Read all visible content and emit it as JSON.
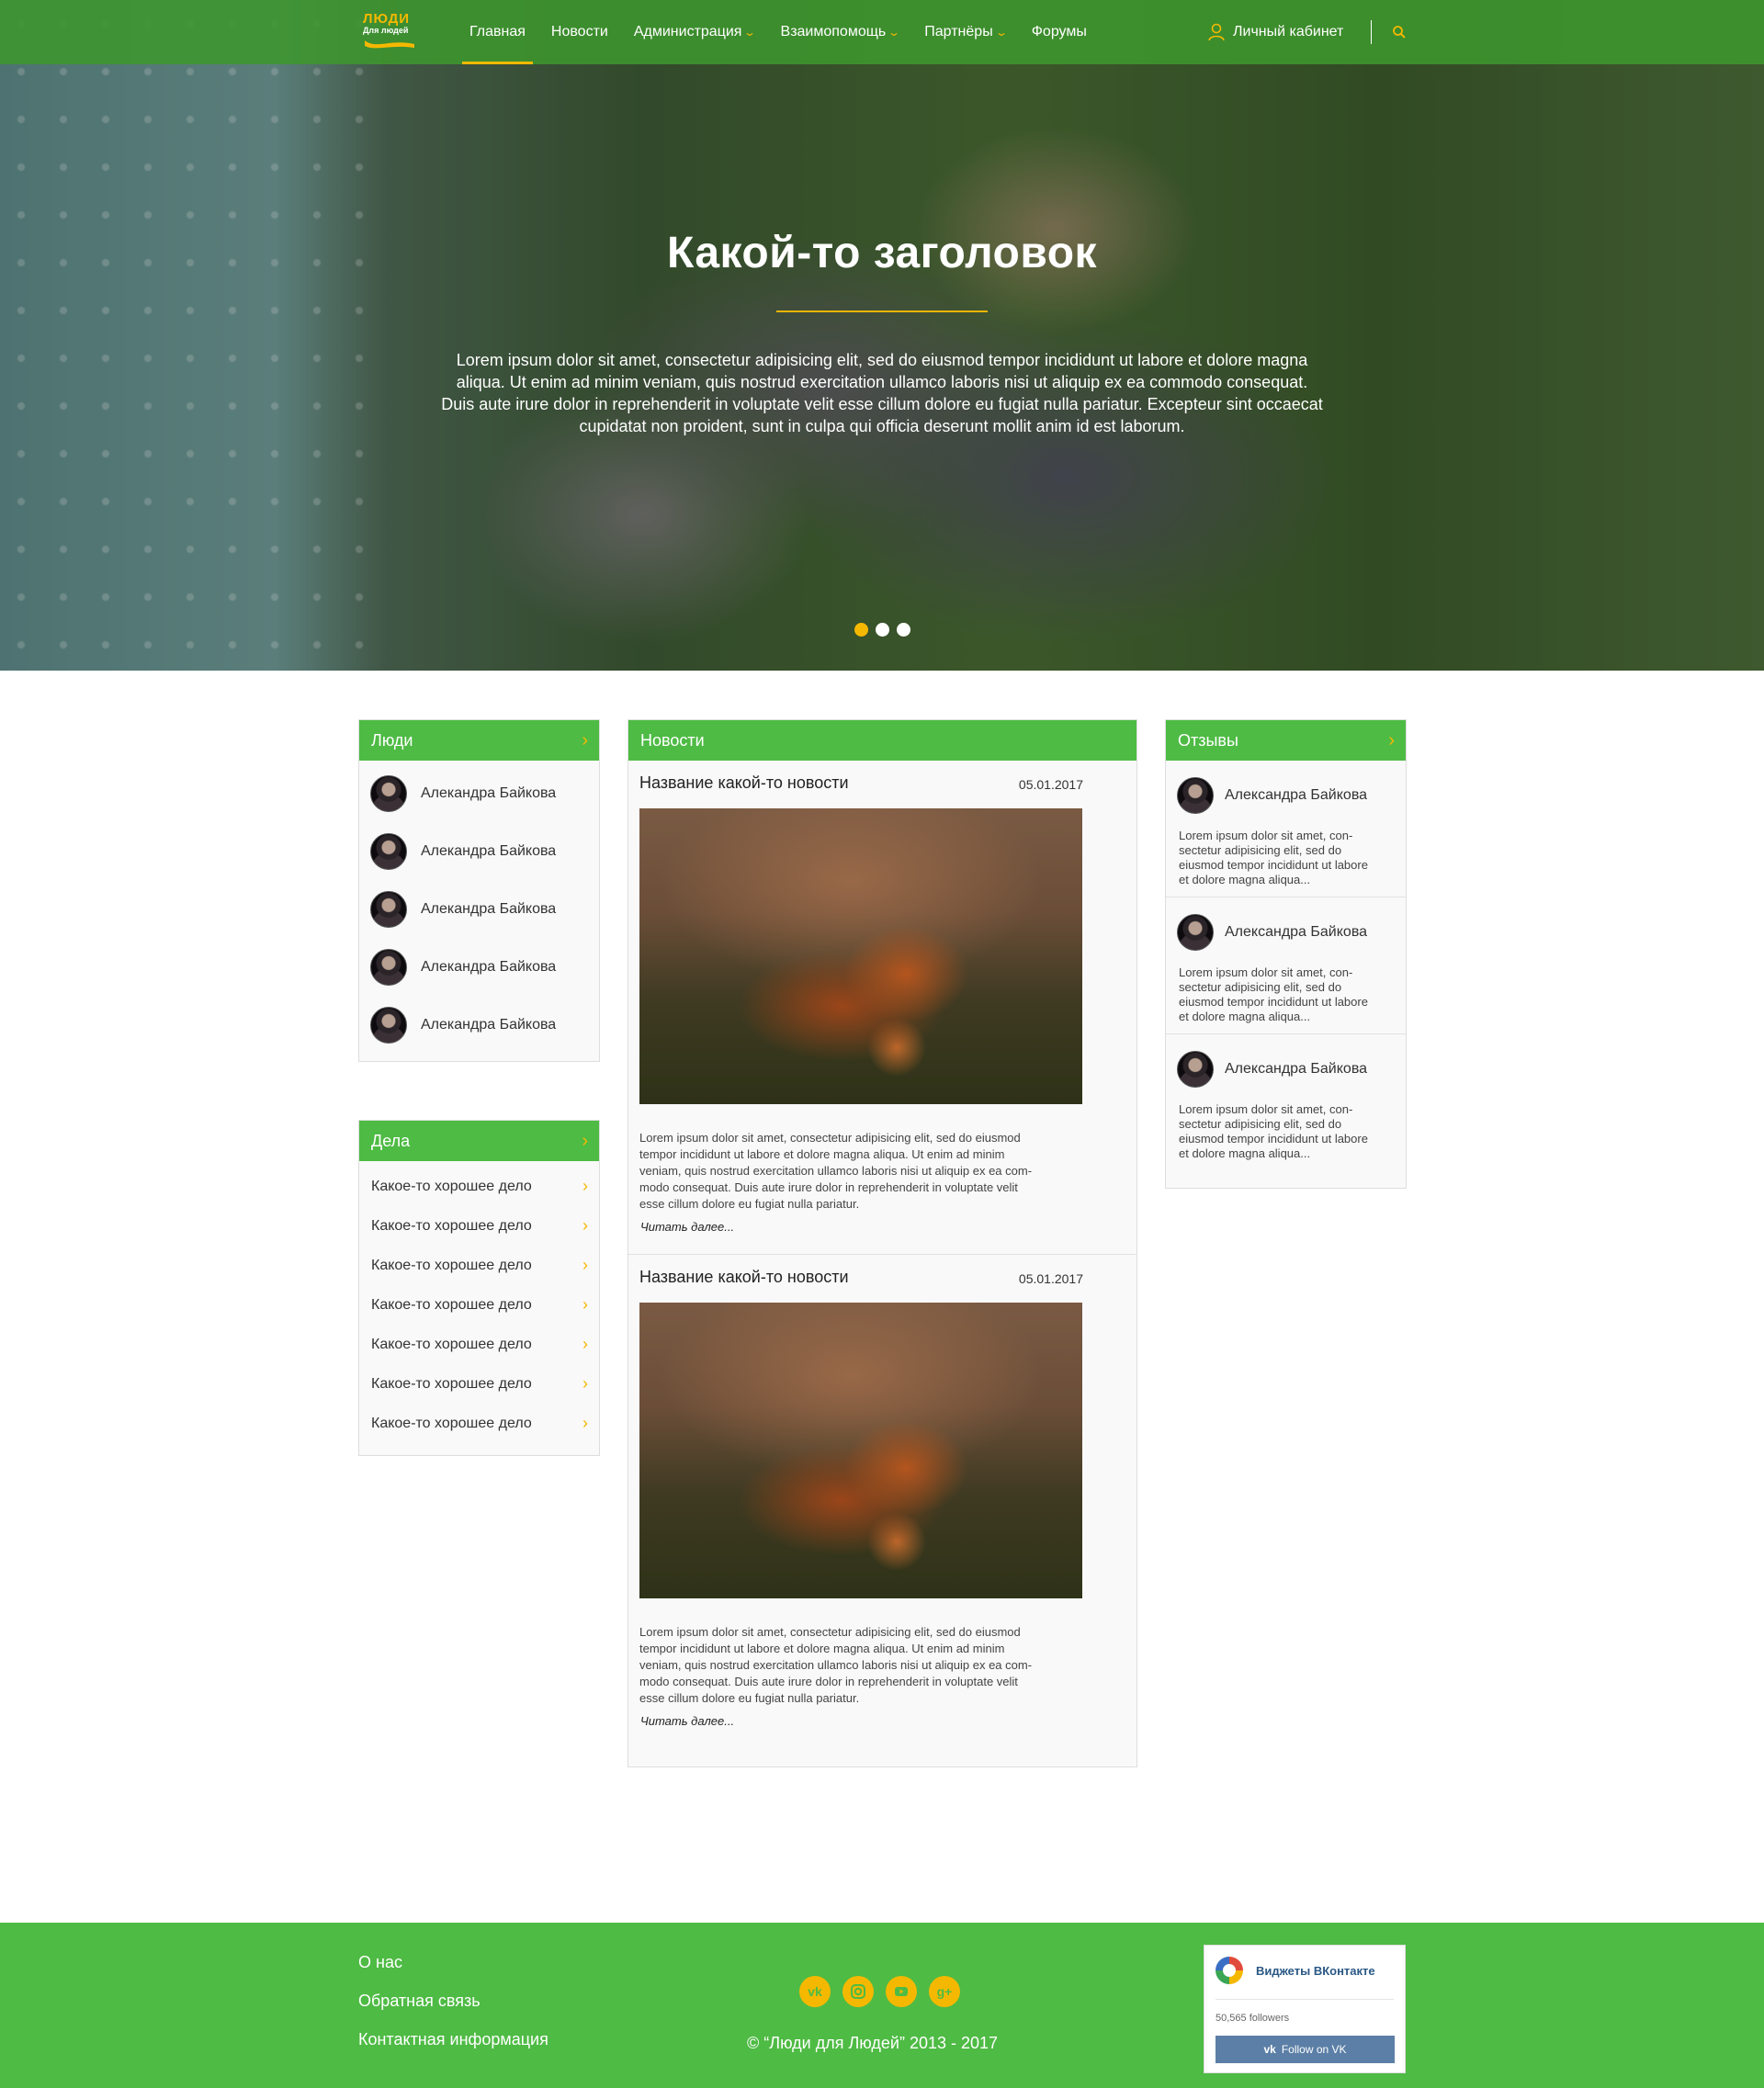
{
  "colors": {
    "brand_green": "#4ebb44",
    "accent_yellow": "#f5b800"
  },
  "logo": {
    "line1": "ЛЮДИ",
    "line2": "Для людей"
  },
  "nav": {
    "items": [
      {
        "label": "Главная",
        "active": true,
        "dropdown": false
      },
      {
        "label": "Новости",
        "active": false,
        "dropdown": false
      },
      {
        "label": "Администрация",
        "active": false,
        "dropdown": true
      },
      {
        "label": "Взаимопомощь",
        "active": false,
        "dropdown": true
      },
      {
        "label": "Партнёры",
        "active": false,
        "dropdown": true
      },
      {
        "label": "Форумы",
        "active": false,
        "dropdown": false
      }
    ],
    "account_label": "Личный кабинет",
    "account_icon": "user-icon",
    "search_icon": "search-icon"
  },
  "hero": {
    "title": "Какой-то заголовок",
    "text": "Lorem ipsum dolor sit amet, consectetur adipisicing elit, sed do eiusmod tempor incididunt ut labore et dolore magna aliqua. Ut enim ad minim veniam, quis nostrud exercitation ullamco laboris nisi ut aliquip ex ea commodo consequat. Duis aute irure dolor in reprehenderit in voluptate velit esse cillum dolore eu fugiat nulla pariatur. Excepteur sint occaecat cupidatat non proident, sunt in culpa qui officia deserunt mollit anim id est laborum.",
    "slides": 3,
    "active_slide": 1
  },
  "people": {
    "title": "Люди",
    "items": [
      {
        "name": "Алекандра  Байкова"
      },
      {
        "name": "Алекандра  Байкова"
      },
      {
        "name": "Алекандра  Байкова"
      },
      {
        "name": "Алекандра  Байкова"
      },
      {
        "name": "Алекандра  Байкова"
      }
    ]
  },
  "deeds": {
    "title": "Дела",
    "items": [
      {
        "label": "Какое-то хорошее дело"
      },
      {
        "label": "Какое-то хорошее дело"
      },
      {
        "label": "Какое-то хорошее дело"
      },
      {
        "label": "Какое-то хорошее дело"
      },
      {
        "label": "Какое-то хорошее дело"
      },
      {
        "label": "Какое-то хорошее дело"
      },
      {
        "label": "Какое-то хорошее дело"
      }
    ]
  },
  "news": {
    "title": "Новости",
    "items": [
      {
        "title": "Название какой-то новости",
        "date": "05.01.2017",
        "lines": [
          "Lorem ipsum dolor sit amet, consectetur adipisicing elit, sed do eiusmod",
          "tempor incididunt ut labore et dolore magna aliqua. Ut enim ad minim",
          "veniam, quis nostrud exercitation ullamco laboris nisi ut aliquip ex ea com-",
          "modo consequat. Duis aute irure dolor in reprehenderit in voluptate velit",
          "esse cillum dolore eu fugiat nulla pariatur."
        ],
        "read_more": "Читать далее..."
      },
      {
        "title": "Название какой-то новости",
        "date": "05.01.2017",
        "lines": [
          "Lorem ipsum dolor sit amet, consectetur adipisicing elit, sed do eiusmod",
          "tempor incididunt ut labore et dolore magna aliqua. Ut enim ad minim",
          "veniam, quis nostrud exercitation ullamco laboris nisi ut aliquip ex ea com-",
          "modo consequat. Duis aute irure dolor in reprehenderit in voluptate velit",
          "esse cillum dolore eu fugiat nulla pariatur."
        ],
        "read_more": "Читать далее..."
      }
    ]
  },
  "reviews": {
    "title": "Отзывы",
    "items": [
      {
        "name": "Александра Байкова",
        "lines": [
          "Lorem ipsum dolor sit amet, con-",
          "sectetur adipisicing elit, sed do",
          "eiusmod tempor incididunt ut labore",
          "et dolore magna aliqua..."
        ]
      },
      {
        "name": "Александра Байкова",
        "lines": [
          "Lorem ipsum dolor sit amet, con-",
          "sectetur adipisicing elit, sed do",
          "eiusmod tempor incididunt ut labore",
          "et dolore magna aliqua..."
        ]
      },
      {
        "name": "Александра Байкова",
        "lines": [
          "Lorem ipsum dolor sit amet, con-",
          "sectetur adipisicing elit, sed do",
          "eiusmod tempor incididunt ut labore",
          "et dolore magna aliqua..."
        ]
      }
    ]
  },
  "footer": {
    "links": [
      "О нас",
      "Обратная связь",
      "Контактная информация"
    ],
    "socials": [
      "vk-icon",
      "instagram-icon",
      "youtube-icon",
      "google-plus-icon"
    ],
    "copyright": "© “Люди для Людей”  2013 - 2017",
    "vk_widget": {
      "title": "Виджеты ВКонтакте",
      "followers": "50,565 followers",
      "button": "Follow on VK"
    }
  }
}
